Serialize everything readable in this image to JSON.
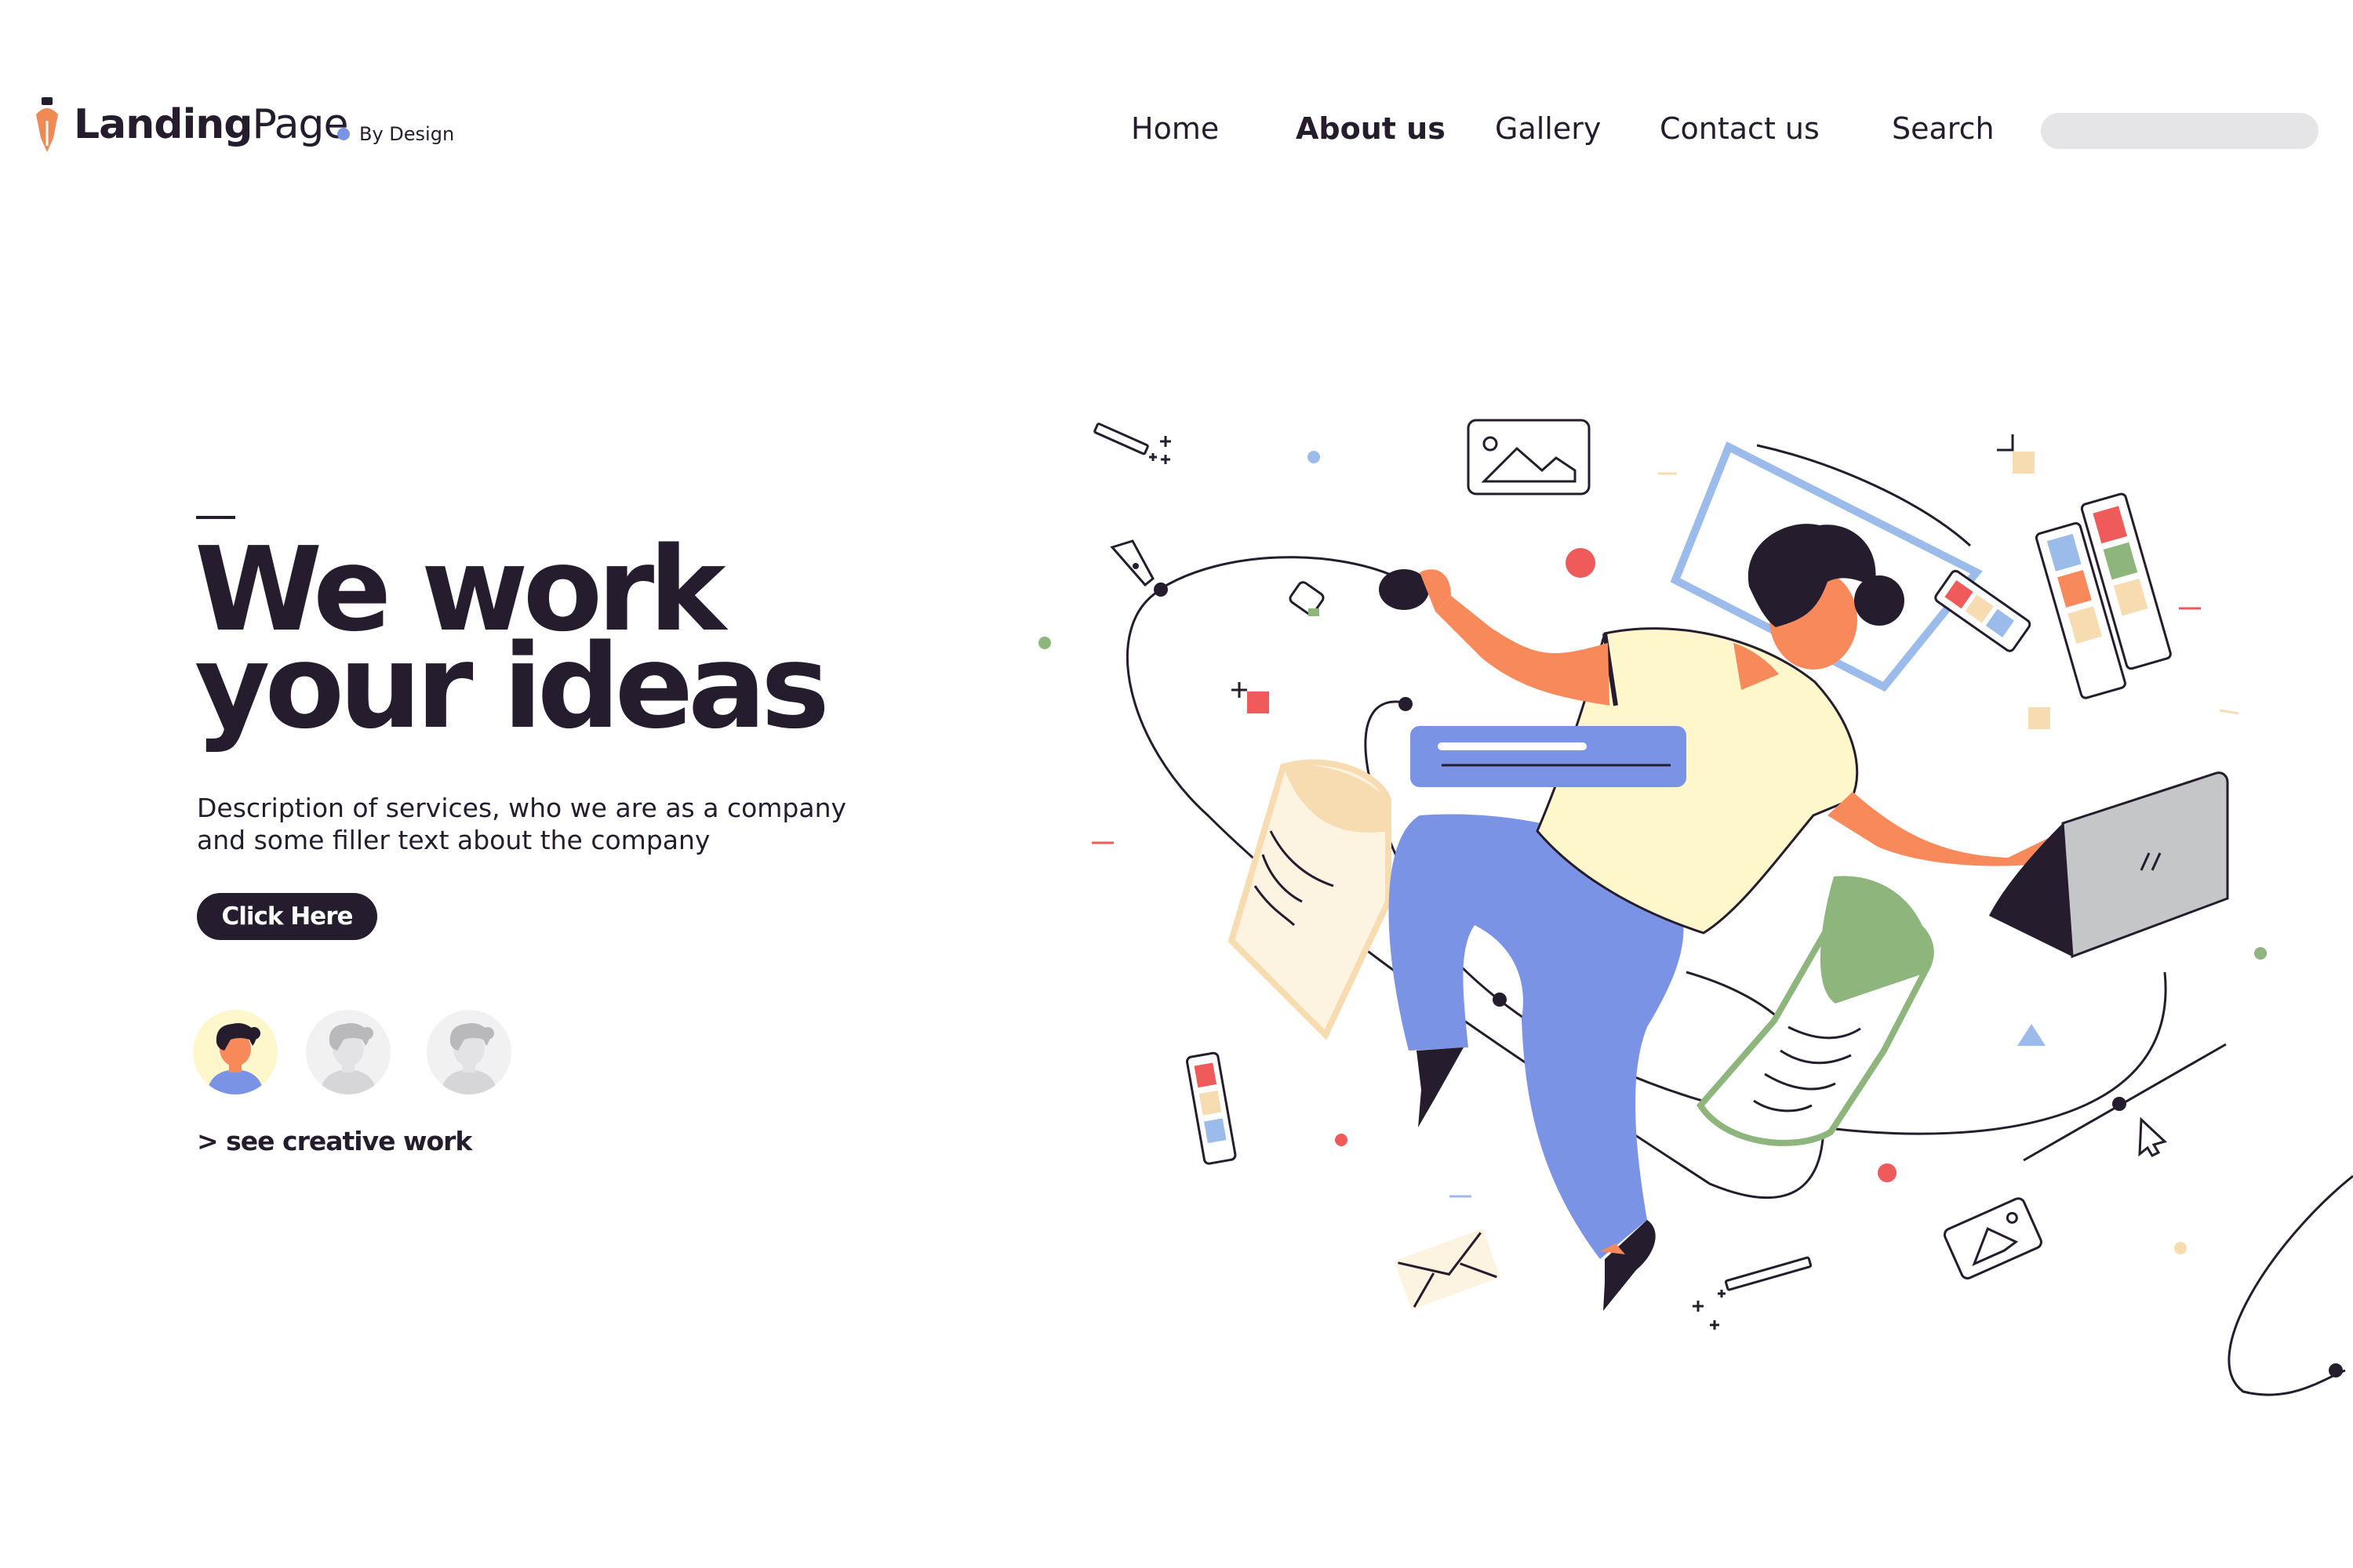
{
  "brand": {
    "name_bold": "Landing",
    "name_light": "Page",
    "tagline": "By Design",
    "accent_colors": {
      "pen": "#f08a55",
      "dot": "#7b93e4"
    }
  },
  "nav": {
    "items": [
      {
        "label": "Home",
        "active": false
      },
      {
        "label": "About us",
        "active": true
      },
      {
        "label": "Gallery",
        "active": false
      },
      {
        "label": "Contact us",
        "active": false
      },
      {
        "label": "Search",
        "active": false
      }
    ],
    "search_value": ""
  },
  "hero": {
    "title_line1": "We work",
    "title_line2": "your ideas",
    "description_line1": "Description of services, who we are as a company",
    "description_line2": "and some filler text about the company",
    "cta_label": "Click Here",
    "avatars": [
      {
        "name": "avatar-active-icon",
        "style": "color"
      },
      {
        "name": "avatar-muted-icon",
        "style": "grey"
      },
      {
        "name": "avatar-muted-icon",
        "style": "grey"
      }
    ],
    "see_more_label": "> see creative work"
  },
  "colors": {
    "text_dark": "#251c2e",
    "blue": "#7b93e4",
    "orange_skin": "#f7895a",
    "shirt": "#fdf7cb",
    "green": "#8db57c",
    "peach": "#f7dcb2",
    "red": "#ef5b5b",
    "laptop": "#c4c6c8"
  },
  "illustration": {
    "name": "creative-worker-illustration"
  }
}
